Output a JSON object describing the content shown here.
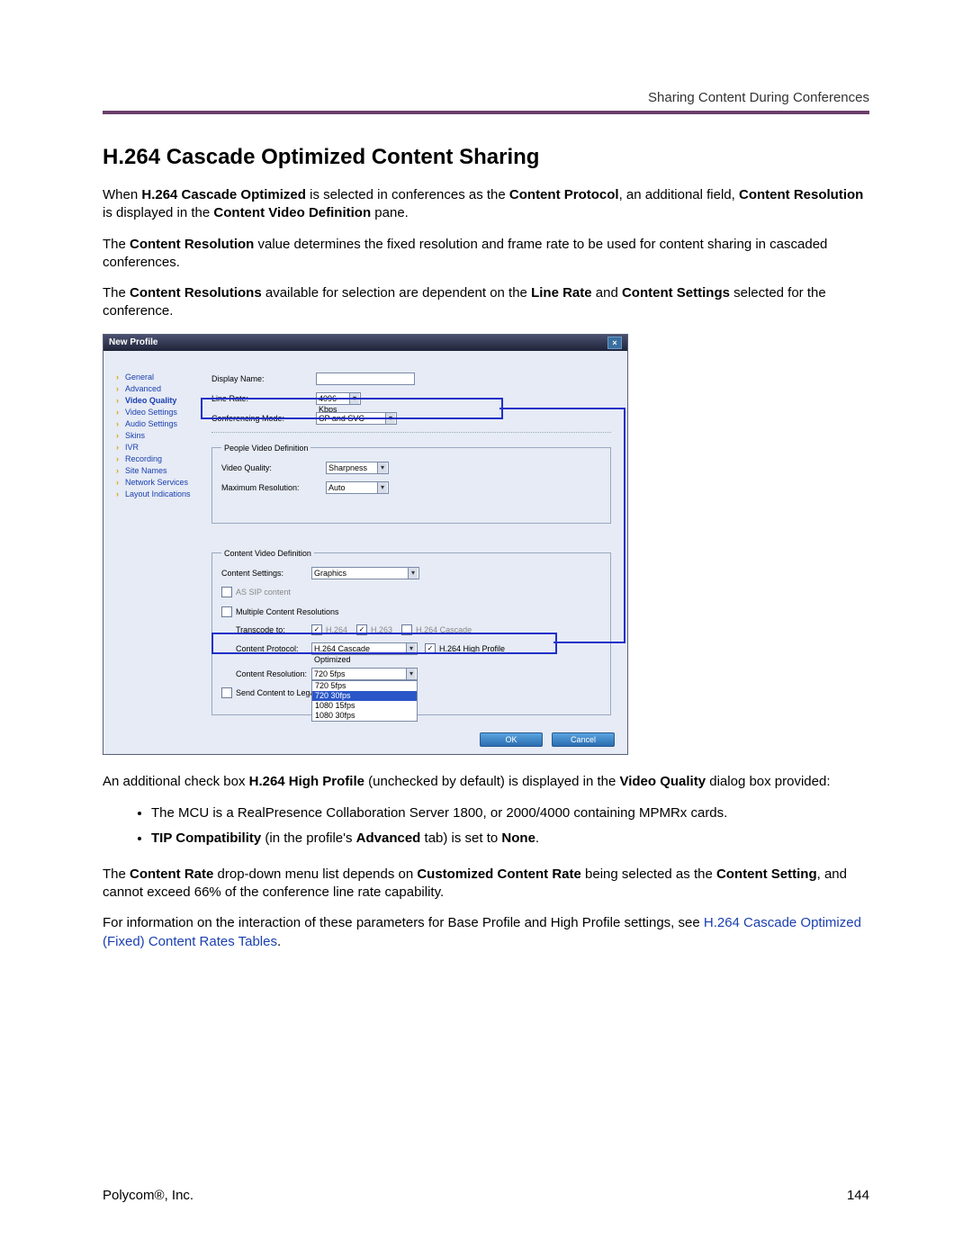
{
  "header": {
    "running_title": "Sharing Content During Conferences"
  },
  "section_title": "H.264 Cascade Optimized Content Sharing",
  "para1_pre": "When ",
  "para1_b1": "H.264 Cascade Optimized",
  "para1_mid1": " is selected in conferences as the ",
  "para1_b2": "Content Protocol",
  "para1_mid2": ", an additional field, ",
  "para1_b3": "Content Resolution",
  "para1_mid3": " is displayed in the ",
  "para1_b4": "Content Video Definition",
  "para1_tail": " pane.",
  "para2_pre": "The ",
  "para2_b1": "Content Resolution",
  "para2_tail": " value determines the fixed resolution and frame rate to be used for content sharing in cascaded conferences.",
  "para3_pre": "The ",
  "para3_b1": "Content Resolutions",
  "para3_mid1": " available for selection are dependent on the ",
  "para3_b2": "Line Rate",
  "para3_mid2": " and ",
  "para3_b3": "Content Settings",
  "para3_tail": " selected for the conference.",
  "para4_pre": "An additional check box ",
  "para4_b1": "H.264 High Profile",
  "para4_mid": " (unchecked by default) is displayed in the ",
  "para4_b2": "Video Quality",
  "para4_tail": " dialog box provided:",
  "bullet1": "The MCU is a RealPresence Collaboration Server 1800, or 2000/4000 containing MPMRx cards.",
  "bullet2_b1": "TIP Compatibility",
  "bullet2_mid": " (in the profile's ",
  "bullet2_b2": "Advanced",
  "bullet2_mid2": " tab) is set to ",
  "bullet2_b3": "None",
  "bullet2_tail": ".",
  "para5_pre": "The ",
  "para5_b1": "Content Rate",
  "para5_mid1": " drop-down menu list depends on ",
  "para5_b2": "Customized Content Rate",
  "para5_mid2": " being selected as the ",
  "para5_b3": "Content Setting",
  "para5_tail": ", and cannot exceed 66% of the conference line rate capability.",
  "para6_pre": "For information on the interaction of these parameters for Base Profile and High Profile settings, see ",
  "para6_link": "H.264 Cascade Optimized (Fixed) Content Rates Tables",
  "para6_tail": ".",
  "footer": {
    "company": "Polycom®, Inc.",
    "page_no": "144"
  },
  "dialog": {
    "title": "New Profile",
    "nav": {
      "items": [
        "General",
        "Advanced",
        "Video Quality",
        "Video Settings",
        "Audio Settings",
        "Skins",
        "IVR",
        "Recording",
        "Site Names",
        "Network Services",
        "Layout Indications"
      ],
      "selected": "Video Quality"
    },
    "fields": {
      "display_name_label": "Display Name:",
      "display_name_value": "",
      "line_rate_label": "Line Rate:",
      "line_rate_value": "4096 Kbps",
      "conf_mode_label": "Conferencing Mode:",
      "conf_mode_value": "CP and SVC"
    },
    "people": {
      "legend": "People Video Definition",
      "video_quality_label": "Video Quality:",
      "video_quality_value": "Sharpness",
      "max_res_label": "Maximum Resolution:",
      "max_res_value": "Auto"
    },
    "content": {
      "legend": "Content Video Definition",
      "content_settings_label": "Content Settings:",
      "content_settings_value": "Graphics",
      "as_sip_label": "AS SIP content",
      "multi_res_label": "Multiple Content Resolutions",
      "transcode_label": "Transcode to:",
      "trans_h264": "H.264",
      "trans_h263": "H.263",
      "trans_h264c": "H.264 Cascade",
      "content_protocol_label": "Content Protocol:",
      "content_protocol_value": "H.264 Cascade Optimized",
      "high_profile_label": "H.264 High Profile",
      "content_resolution_label": "Content Resolution:",
      "content_resolution_selected": "720 5fps",
      "content_resolution_options": [
        "720 5fps",
        "720 30fps",
        "1080 15fps",
        "1080 30fps"
      ],
      "send_legacy_label": "Send Content to Legacy en"
    },
    "buttons": {
      "ok": "OK",
      "cancel": "Cancel"
    }
  }
}
